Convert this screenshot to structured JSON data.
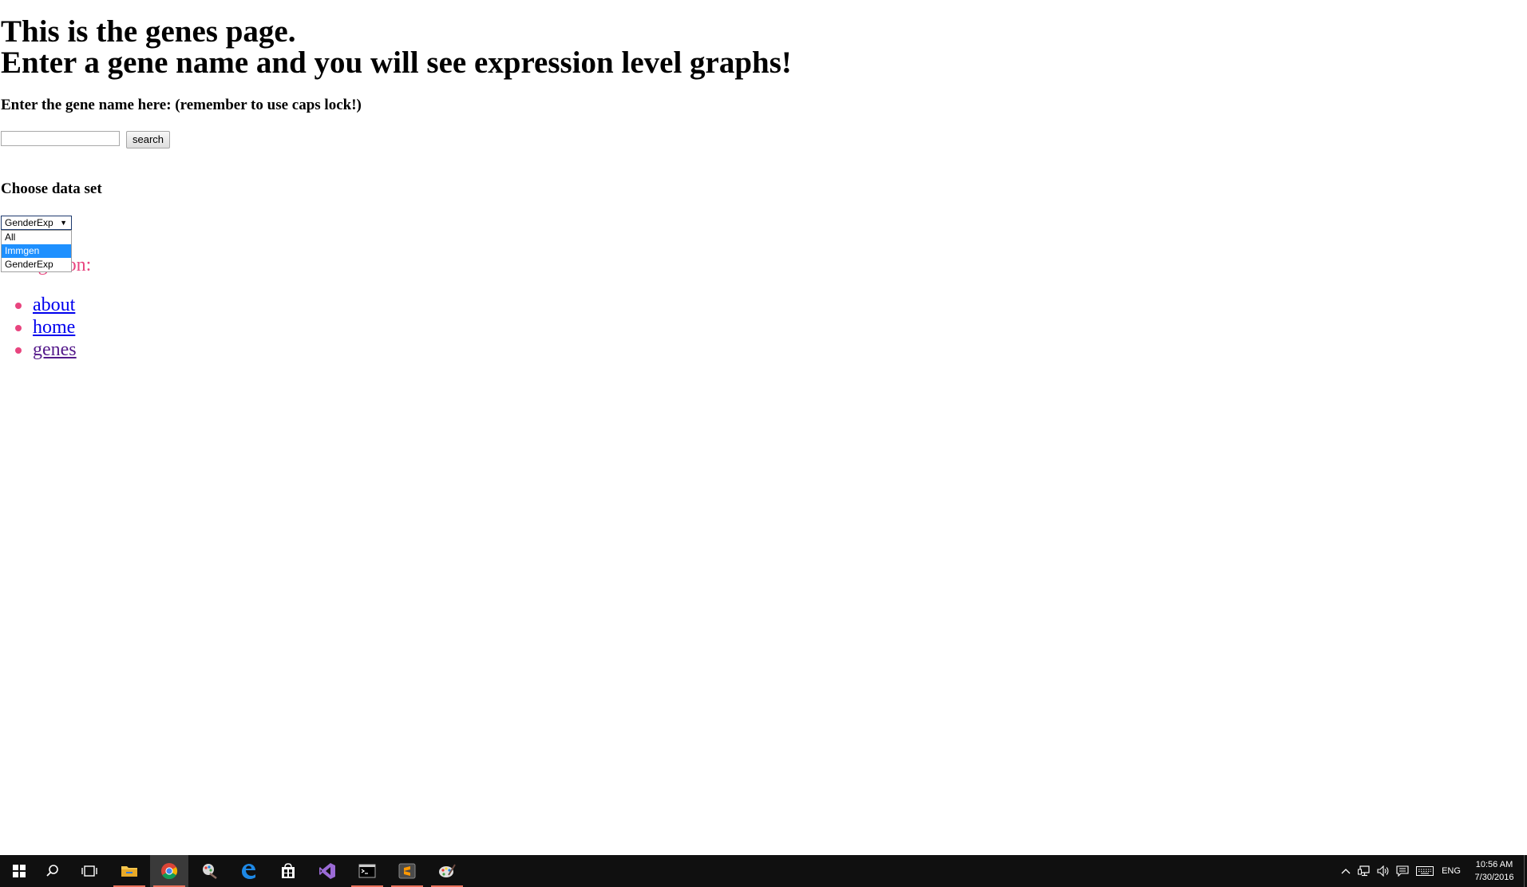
{
  "page": {
    "title_line1": "This is the genes page.",
    "title_line2": "Enter a gene name and you will see expression level graphs!",
    "gene_prompt": "Enter the gene name here: (remember to use caps lock!)",
    "search": {
      "value": "",
      "placeholder": "",
      "button_label": "search"
    },
    "dataset": {
      "label": "Choose data set",
      "selected": "GenderExp",
      "options": [
        "All",
        "Immgen",
        "GenderExp"
      ],
      "highlighted": "Immgen"
    },
    "navigation": {
      "heading": "Navigation:",
      "links": [
        "about",
        "home",
        "genes"
      ]
    }
  },
  "taskbar": {
    "apps": [
      "start-icon",
      "search-icon",
      "task-view-icon",
      "file-explorer-icon",
      "chrome-icon",
      "paint-icon",
      "edge-icon",
      "store-icon",
      "visual-studio-icon",
      "terminal-icon",
      "sublime-icon",
      "paint-palette-icon"
    ],
    "language": "ENG",
    "time": "10:56 AM",
    "date": "7/30/2016"
  },
  "colors": {
    "accent_pink": "#e8457f",
    "link": "#0000ee",
    "visited_link": "#551a8b",
    "select_highlight": "#1e90ff",
    "taskbar_bg": "#101010",
    "running_indicator": "#e8705a"
  }
}
